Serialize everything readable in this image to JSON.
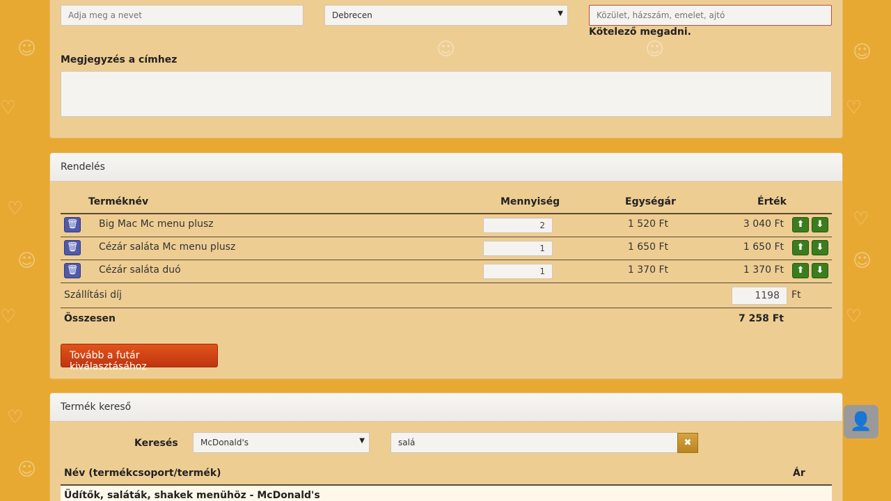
{
  "address": {
    "name_placeholder": "Adja meg a nevet",
    "city_value": "Debrecen",
    "street_placeholder": "Közület, házszám, emelet, ajtó",
    "street_error": "Kötelező megadni.",
    "note_label": "Megjegyzés a címhez",
    "note_value": ""
  },
  "order": {
    "title": "Rendelés",
    "columns": {
      "name": "Terméknév",
      "qty": "Mennyiség",
      "unit": "Egységár",
      "value": "Érték"
    },
    "items": [
      {
        "name": "Big Mac Mc menu plusz",
        "qty": "2",
        "unit": "1 520 Ft",
        "value": "3 040 Ft"
      },
      {
        "name": "Cézár saláta Mc menu plusz",
        "qty": "1",
        "unit": "1 650 Ft",
        "value": "1 650 Ft"
      },
      {
        "name": "Cézár saláta duó",
        "qty": "1",
        "unit": "1 370 Ft",
        "value": "1 370 Ft"
      }
    ],
    "delivery_label": "Szállítási díj",
    "delivery_value": "1198",
    "delivery_unit": "Ft",
    "total_label": "Összesen",
    "total_value": "7 258 Ft",
    "next_button": "Tovább a futár kiválasztásához"
  },
  "search": {
    "title": "Termék kereső",
    "label": "Keresés",
    "restaurant_value": "McDonald's",
    "query_value": "salá",
    "col_name": "Név (termékcsoport/termék)",
    "col_price": "Ár",
    "group_title": "Üdítők, saláták, shakek menühöz - McDonald's"
  },
  "icons": {
    "trash": "trash-icon",
    "up": "arrow-up-icon",
    "down": "arrow-down-icon",
    "clear": "close-icon",
    "user": "user-icon",
    "select": "caret-down-icon"
  },
  "colors": {
    "background": "#e8a933",
    "panel": "#eecd93",
    "primary_button": "#d0451a",
    "arrow_button": "#3a7d1e",
    "trash_button": "#4f5aa8",
    "error": "#b94a48"
  }
}
